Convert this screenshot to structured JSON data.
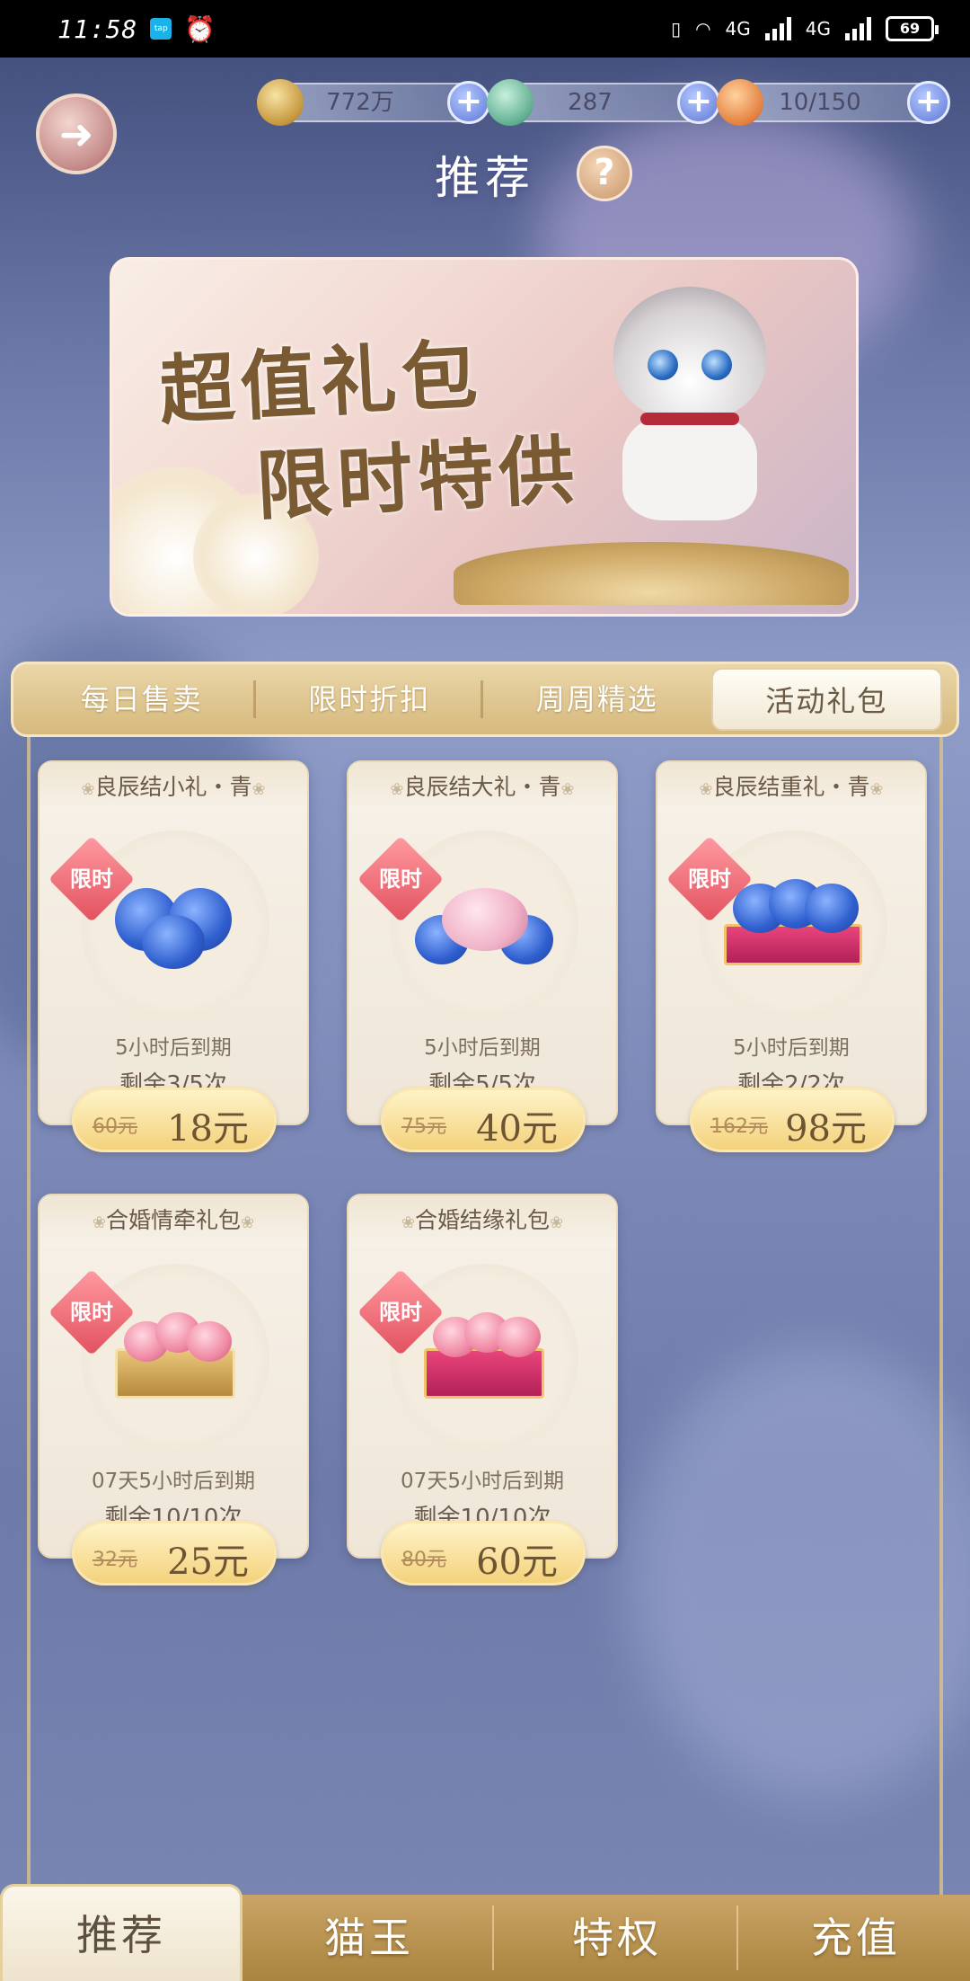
{
  "status_bar": {
    "time": "11:58",
    "app_icon_label": "tap",
    "network": "4G",
    "network2": "4G",
    "battery": "69"
  },
  "resources": [
    {
      "icon": "paw-coin-icon",
      "value": "772万"
    },
    {
      "icon": "jade-frog-icon",
      "value": "287"
    },
    {
      "icon": "food-bowl-icon",
      "value": "10/150"
    }
  ],
  "header": {
    "title": "推荐",
    "help_label": "?"
  },
  "banner": {
    "line1": "超值礼包",
    "line2": "限时特供"
  },
  "tabs": [
    {
      "label": "每日售卖"
    },
    {
      "label": "限时折扣"
    },
    {
      "label": "周周精选"
    },
    {
      "label": "活动礼包"
    }
  ],
  "products": [
    {
      "name": "良辰结小礼・青",
      "badge": "限时",
      "expire": "5小时后到期",
      "remain": "剩余3/5次",
      "old_price": "60元",
      "price": "18元"
    },
    {
      "name": "良辰结大礼・青",
      "badge": "限时",
      "expire": "5小时后到期",
      "remain": "剩余5/5次",
      "old_price": "75元",
      "price": "40元"
    },
    {
      "name": "良辰结重礼・青",
      "badge": "限时",
      "expire": "5小时后到期",
      "remain": "剩余2/2次",
      "old_price": "162元",
      "price": "98元"
    },
    {
      "name": "合婚情牵礼包",
      "badge": "限时",
      "expire": "07天5小时后到期",
      "remain": "剩余10/10次",
      "old_price": "32元",
      "price": "25元"
    },
    {
      "name": "合婚结缘礼包",
      "badge": "限时",
      "expire": "07天5小时后到期",
      "remain": "剩余10/10次",
      "old_price": "80元",
      "price": "60元"
    }
  ],
  "bottom_nav": [
    {
      "label": "推荐"
    },
    {
      "label": "猫玉"
    },
    {
      "label": "特权"
    },
    {
      "label": "充值"
    }
  ]
}
